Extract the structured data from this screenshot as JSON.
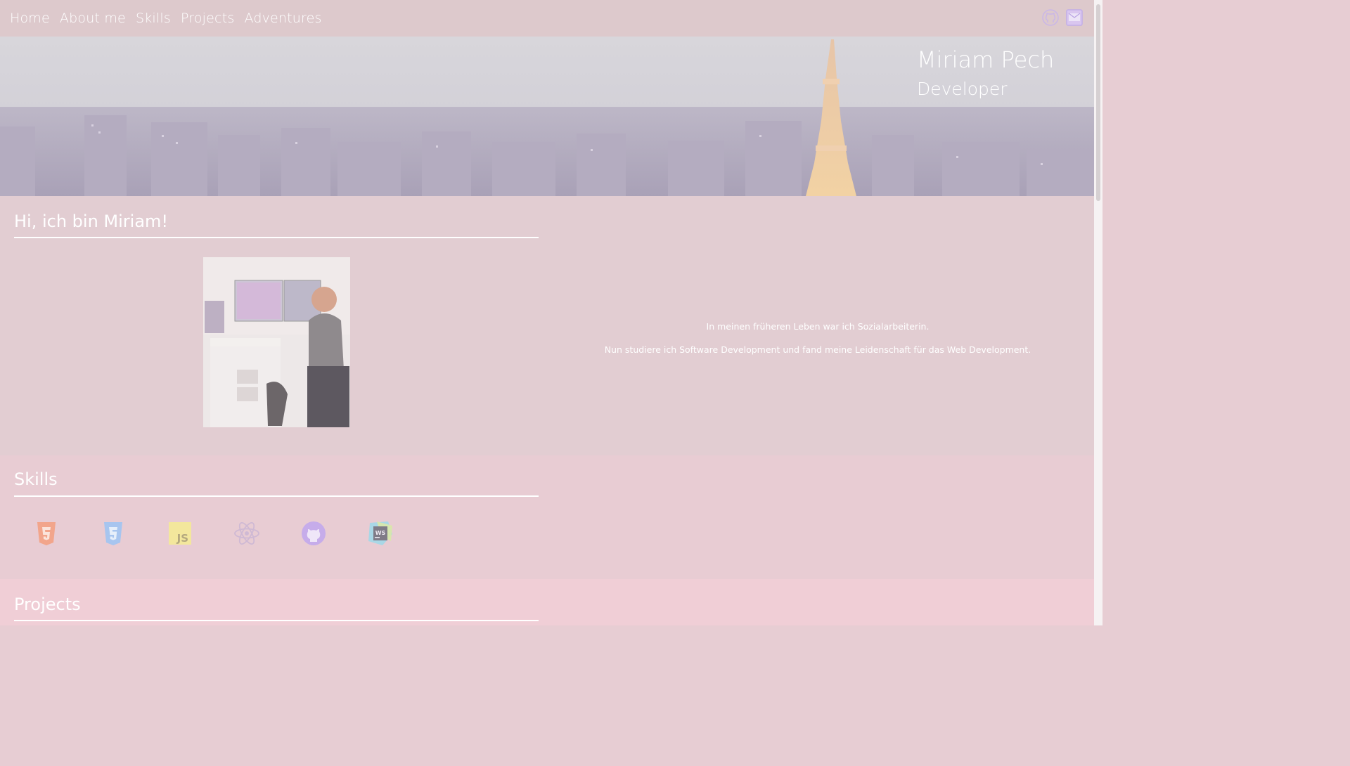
{
  "nav": {
    "links": [
      "Home",
      "About me",
      "Skills",
      "Projects",
      "Adventures"
    ],
    "icons": [
      "github-icon",
      "contact-icon"
    ]
  },
  "hero": {
    "name": "Miriam Pech",
    "role": "Developer"
  },
  "about": {
    "title": "Hi, ich bin Miriam!",
    "lines": [
      "In meinen früheren Leben war ich Sozialarbeiterin.",
      "Nun studiere ich Software Development und fand meine Leidenschaft für das Web Development."
    ],
    "photo_icon": "profile-photo"
  },
  "skills": {
    "title": "Skills",
    "icons": [
      "html5-icon",
      "css3-icon",
      "javascript-icon",
      "react-icon",
      "github-icon",
      "webstorm-icon"
    ],
    "js_badge": "JS",
    "ws_badge": "WS"
  },
  "projects": {
    "title": "Projects"
  },
  "colors": {
    "nav_bg": "#ddc9cc",
    "about_bg": "#e2cdd2",
    "skills_bg": "#e8ccd3",
    "projects_bg": "#f0ced6",
    "text": "#ffffff"
  }
}
